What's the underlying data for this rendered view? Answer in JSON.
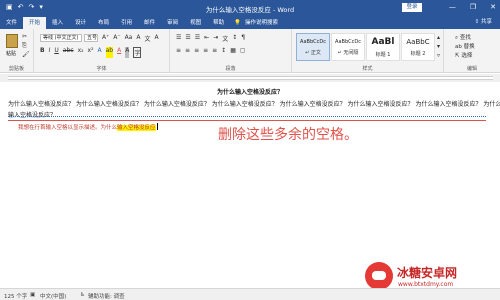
{
  "window": {
    "title": "为什么输入空格没反应 - Word",
    "login_label": "登录",
    "controls": {
      "minimize": "—",
      "restore": "❐",
      "close": "✕"
    },
    "qat_icons": [
      "save-icon",
      "undo-icon",
      "redo-icon",
      "customize-icon"
    ]
  },
  "tabs": {
    "items": [
      "文件",
      "开始",
      "插入",
      "设计",
      "布局",
      "引用",
      "邮件",
      "审阅",
      "视图",
      "帮助"
    ],
    "active": "开始",
    "search_label": "操作说明搜索",
    "share_label": "共享"
  },
  "ribbon": {
    "clipboard": {
      "paste_label": "粘贴",
      "group_label": "剪贴板"
    },
    "font": {
      "font_name": "等线 (中文正文)",
      "font_size": "五号",
      "group_label": "字体",
      "row1": [
        "A⁺",
        "A⁻",
        "Aa",
        "A",
        "文",
        "A"
      ],
      "row2": [
        "B",
        "I",
        "U",
        "abc",
        "x₂",
        "x²",
        "A",
        "ab",
        "A",
        "A",
        "字"
      ]
    },
    "paragraph": {
      "group_label": "段落",
      "row1": [
        "☰",
        "☰",
        "☰",
        "⇤",
        "⇥",
        "文",
        "↕",
        "¶"
      ],
      "row2": [
        "≡",
        "≡",
        "≡",
        "≡",
        "≡",
        "↕",
        "▦",
        "▢"
      ]
    },
    "styles": {
      "group_label": "样式",
      "items": [
        {
          "sample": "AaBbCcDc",
          "name": "↵ 正文"
        },
        {
          "sample": "AaBbCcDc",
          "name": "↵ 无间隔"
        },
        {
          "sample": "AaBl",
          "name": "标题 1"
        },
        {
          "sample": "AaBbC",
          "name": "标题 2"
        }
      ]
    },
    "editing": {
      "group_label": "编辑",
      "find": "⌕ 查找",
      "replace": "ab 替换",
      "select": "⇱ 选择"
    }
  },
  "document": {
    "heading": "为什么输入空格没反应？",
    "line1": "为什么输入空格没反应？ 为什么输入空格没反应？ 为什么输入空格没反应？ 为什么输入空格没反应？ 为什么输入空格没反应？ 为什么输入空格没反应？ 为什么输入空格没反应？ 为什么",
    "line2": "输入空格没反应？",
    "note_prefix": "我想在行首输入空格以显示描述。",
    "note_mid": "为什么",
    "note_highlight": "输入空格没反应",
    "annotation": "删除这些多余的空格。"
  },
  "status": {
    "word_count": "125 个字",
    "language": "中文(中国)",
    "accessibility": "辅助功能: 调查"
  },
  "watermark": {
    "name": "冰糖安卓网",
    "url": "www.btxtdmy.com"
  },
  "colors": {
    "ribbon_blue": "#2b579a",
    "annotation_red": "#e0524a",
    "highlight_yellow": "#fff200"
  }
}
